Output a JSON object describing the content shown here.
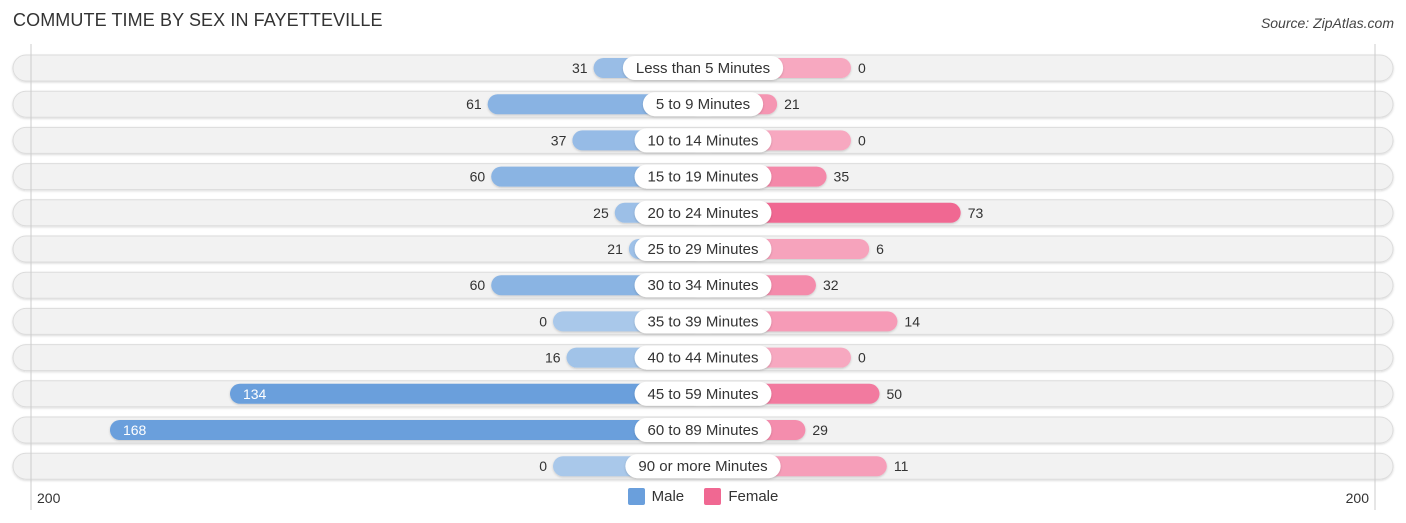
{
  "header": {
    "title": "COMMUTE TIME BY SEX IN FAYETTEVILLE",
    "source": "Source: ZipAtlas.com"
  },
  "colors": {
    "male": "#6a9fdc",
    "male_light": "#a9c8ea",
    "female": "#f06892",
    "female_light": "#f7a8c0",
    "track": "#f2f2f2"
  },
  "legend": [
    {
      "label": "Male",
      "color": "#6a9fdc"
    },
    {
      "label": "Female",
      "color": "#f06892"
    }
  ],
  "chart_data": {
    "type": "bar",
    "orientation": "horizontal-diverging",
    "title": "COMMUTE TIME BY SEX IN FAYETTEVILLE",
    "categories": [
      "Less than 5 Minutes",
      "5 to 9 Minutes",
      "10 to 14 Minutes",
      "15 to 19 Minutes",
      "20 to 24 Minutes",
      "25 to 29 Minutes",
      "30 to 34 Minutes",
      "35 to 39 Minutes",
      "40 to 44 Minutes",
      "45 to 59 Minutes",
      "60 to 89 Minutes",
      "90 or more Minutes"
    ],
    "series": [
      {
        "name": "Male",
        "side": "left",
        "values": [
          31,
          61,
          37,
          60,
          25,
          21,
          60,
          0,
          16,
          134,
          168,
          0
        ]
      },
      {
        "name": "Female",
        "side": "right",
        "values": [
          0,
          21,
          0,
          35,
          73,
          6,
          32,
          14,
          0,
          50,
          29,
          11
        ]
      }
    ],
    "axis": {
      "left_label": "200",
      "right_label": "200",
      "max": 200
    },
    "legend_position": "bottom-center",
    "grid": false
  }
}
